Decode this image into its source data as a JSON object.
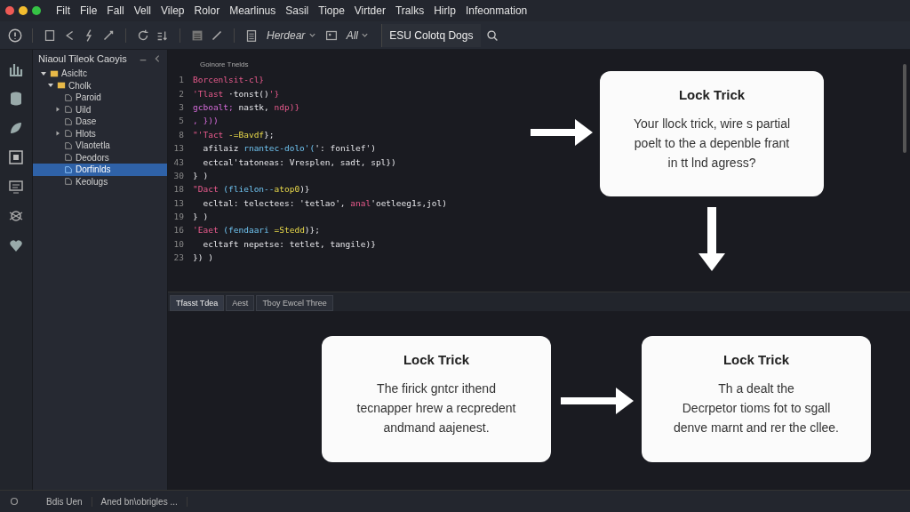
{
  "menu_bar": {
    "items": [
      "Filt",
      "File",
      "Fall",
      "Vell",
      "Vilep",
      "Rolor",
      "Mearlinus",
      "Sasil",
      "Tiope",
      "Virtder",
      "Tralks",
      "Hirlp",
      "Infeonmation"
    ]
  },
  "toolbar": {
    "dropdowns": [
      "Herdear",
      "All"
    ],
    "search": {
      "value": "ESU Colotq Dogs"
    }
  },
  "sidebar": {
    "title": "Niaoul Tileok Caoyis",
    "tree": [
      {
        "label": "Asicltc",
        "kind": "folder",
        "expanded": true,
        "selected": false,
        "children": [
          {
            "label": "Cholk",
            "kind": "folder",
            "expanded": true,
            "selected": false,
            "children": [
              {
                "label": "Paroid",
                "kind": "file",
                "selected": false
              },
              {
                "label": "Uild",
                "kind": "file",
                "expanded": false,
                "selected": false
              },
              {
                "label": "Dase",
                "kind": "file",
                "selected": false
              },
              {
                "label": "Hlots",
                "kind": "file",
                "expanded": false,
                "selected": false
              },
              {
                "label": "Vlaotetla",
                "kind": "file",
                "selected": false
              },
              {
                "label": "Deodors",
                "kind": "file",
                "selected": false
              },
              {
                "label": "Dorfinlds",
                "kind": "file",
                "selected": true
              },
              {
                "label": "Keolugs",
                "kind": "file",
                "selected": false
              }
            ]
          }
        ]
      }
    ]
  },
  "editor": {
    "tab": "Goinore Tnelds",
    "lines": [
      {
        "number": "1",
        "segments": [
          {
            "text": "Borcenlsit-cl}",
            "kind": "string"
          }
        ]
      },
      {
        "number": "2",
        "segments": [
          {
            "text": "'Tlast ",
            "kind": "string"
          },
          {
            "text": "·tonst()",
            "kind": "plain"
          },
          {
            "text": "'}",
            "kind": "string"
          }
        ]
      },
      {
        "number": "3",
        "segments": [
          {
            "text": "gcboalt; ",
            "kind": "keyword"
          },
          {
            "text": "nastk, ",
            "kind": "plain"
          },
          {
            "text": "ndp)}",
            "kind": "string"
          }
        ]
      },
      {
        "number": "5",
        "segments": [
          {
            "text": ", }))",
            "kind": "keyword"
          }
        ]
      },
      {
        "number": "8",
        "segments": [
          {
            "text": "\"'Tact ",
            "kind": "string"
          },
          {
            "text": "-=Bavdf",
            "kind": "func"
          },
          {
            "text": "};",
            "kind": "plain"
          }
        ]
      },
      {
        "number": "13",
        "segments": [
          {
            "text": "  afilaiz ",
            "kind": "plain"
          },
          {
            "text": "rnantec-dolo'(",
            "kind": "type"
          },
          {
            "text": "': fonilef')",
            "kind": "plain"
          }
        ]
      },
      {
        "number": "43",
        "segments": [
          {
            "text": "  ectcal'tatoneas: Vresplen, sadt, spl})",
            "kind": "plain"
          }
        ]
      },
      {
        "number": "30",
        "segments": [
          {
            "text": "} )",
            "kind": "plain"
          }
        ]
      },
      {
        "number": "18",
        "segments": [
          {
            "text": "\"Dact ",
            "kind": "string"
          },
          {
            "text": "(flielon--",
            "kind": "type"
          },
          {
            "text": "atop0",
            "kind": "func"
          },
          {
            "text": ")}",
            "kind": "plain"
          }
        ]
      },
      {
        "number": "13",
        "segments": [
          {
            "text": "  ecltal: telectees: 'tetlao', ",
            "kind": "plain"
          },
          {
            "text": "anal",
            "kind": "string"
          },
          {
            "text": "'oetleeg1s,jol)",
            "kind": "plain"
          }
        ]
      },
      {
        "number": "19",
        "segments": [
          {
            "text": "} )",
            "kind": "plain"
          }
        ]
      },
      {
        "number": "16",
        "segments": [
          {
            "text": "'Eaet ",
            "kind": "string"
          },
          {
            "text": "(fendaari ",
            "kind": "type"
          },
          {
            "text": "=Stedd",
            "kind": "func"
          },
          {
            "text": ")};",
            "kind": "plain"
          }
        ]
      },
      {
        "number": "10",
        "segments": [
          {
            "text": "  ecltaft nepetse: tetlet, tangile)}",
            "kind": "plain"
          }
        ]
      },
      {
        "number": "23",
        "segments": [
          {
            "text": "}) )",
            "kind": "plain"
          }
        ]
      }
    ],
    "card": {
      "title": "Lock Trick",
      "lines": [
        "Your llock trick, wire s partial",
        "poelt to the a depenble frant",
        "in tt lnd agress?"
      ]
    }
  },
  "panel": {
    "tabs": [
      {
        "label": "Tfasst Tdea",
        "selected": true
      },
      {
        "label": "Aest",
        "selected": false
      },
      {
        "label": "Tboy Ewcel Three",
        "selected": false
      }
    ],
    "cards": [
      {
        "title": "Lock Trick",
        "lines": [
          "The firick gntcr ithend",
          "tecnapper hrew a recpredent",
          "andmand aajenest."
        ]
      },
      {
        "title": "Lock Trick",
        "lines": [
          "Th a dealt the",
          "Decrpetor tioms fot to sgall",
          "denve marnt and rer the cllee."
        ]
      }
    ]
  },
  "status_bar": {
    "items": [
      "Bdis Uen",
      "Aned bn\\obrigles ..."
    ]
  }
}
